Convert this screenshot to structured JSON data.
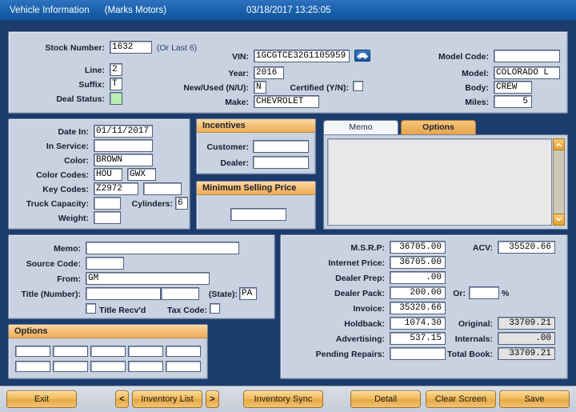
{
  "titlebar": {
    "title": "Vehicle Information",
    "dealer": "(Marks Motors)",
    "datetime": "03/18/2017 13:25:05"
  },
  "header_panel": {
    "stock_number_label": "Stock Number:",
    "stock_number_value": "1632",
    "stock_number_hint": "(Or Last 6)",
    "line_label": "Line:",
    "line_value": "2",
    "suffix_label": "Suffix:",
    "suffix_value": "T",
    "deal_status_label": "Deal Status:",
    "deal_status_value": "",
    "vin_label": "VIN:",
    "vin_value": "1GCGTCE32G1105959",
    "vin_icon": "car-icon",
    "year_label": "Year:",
    "year_value": "2016",
    "new_used_label": "New/Used (N/U):",
    "new_used_value": "N",
    "certified_label": "Certified (Y/N):",
    "certified_checked": false,
    "make_label": "Make:",
    "make_value": "CHEVROLET",
    "model_code_label": "Model Code:",
    "model_code_value": "",
    "model_label": "Model:",
    "model_value": "COLORADO L",
    "body_label": "Body:",
    "body_value": "CREW",
    "miles_label": "Miles:",
    "miles_value": "5"
  },
  "detail_panel": {
    "date_in_label": "Date In:",
    "date_in_value": "01/11/2017",
    "in_service_label": "In Service:",
    "in_service_value": "",
    "color_label": "Color:",
    "color_value": "BROWN",
    "color_codes_label": "Color Codes:",
    "color_code_1": "HOU",
    "color_code_2": "GWX",
    "key_codes_label": "Key Codes:",
    "key_code_1": "Z2972",
    "key_code_2": "",
    "truck_capacity_label": "Truck Capacity:",
    "truck_capacity_value": "",
    "cylinders_label": "Cylinders:",
    "cylinders_value": "6",
    "weight_label": "Weight:",
    "weight_value": ""
  },
  "incentives": {
    "header": "Incentives",
    "customer_label": "Customer:",
    "customer_value": "",
    "dealer_label": "Dealer:",
    "dealer_value": ""
  },
  "minimum_selling_price": {
    "header": "Minimum Selling Price",
    "value": ""
  },
  "tabs": {
    "memo_label": "Memo",
    "options_label": "Options",
    "active": "Options",
    "list_content": ""
  },
  "memo_panel": {
    "memo_label": "Memo:",
    "memo_value": "",
    "source_code_label": "Source Code:",
    "source_code_value": "",
    "from_label": "From:",
    "from_value": "GM",
    "title_number_label": "Title (Number):",
    "title_number_value": "",
    "title_number_value2": "",
    "state_label": "(State):",
    "state_value": "PA",
    "title_recvd_label": "Title Recv'd",
    "title_recvd_checked": false,
    "tax_code_label": "Tax Code:",
    "tax_code_value": ""
  },
  "options_panel": {
    "header": "Options",
    "cells": [
      "",
      "",
      "",
      "",
      "",
      "",
      "",
      "",
      "",
      ""
    ]
  },
  "pricing": {
    "msrp_label": "M.S.R.P:",
    "msrp_value": "36705.00",
    "internet_price_label": "Internet Price:",
    "internet_price_value": "36705.00",
    "dealer_prep_label": "Dealer Prep:",
    "dealer_prep_value": ".00",
    "dealer_pack_label": "Dealer Pack:",
    "dealer_pack_value": "200.00",
    "or_label": "Or:",
    "or_value": "",
    "percent_symbol": "%",
    "invoice_label": "Invoice:",
    "invoice_value": "35320.66",
    "holdback_label": "Holdback:",
    "holdback_value": "1074.30",
    "advertising_label": "Advertising:",
    "advertising_value": "537.15",
    "pending_repairs_label": "Pending Repairs:",
    "pending_repairs_value": "",
    "acv_label": "ACV:",
    "acv_value": "35520.66",
    "original_label": "Original:",
    "original_value": "33709.21",
    "internals_label": "Internals:",
    "internals_value": ".00",
    "total_book_label": "Total Book:",
    "total_book_value": "33709.21"
  },
  "buttons": {
    "exit": "Exit",
    "prev": "<",
    "inventory_list": "Inventory List",
    "next": ">",
    "inventory_sync": "Inventory Sync",
    "detail": "Detail",
    "clear_screen": "Clear Screen",
    "save": "Save"
  },
  "colors": {
    "title_bar_blue": "#1861ab",
    "window_navy": "#1d3c6e",
    "panel_gray": "#c9d2e0",
    "section_orange": "#f0bb6a",
    "button_gold": "#efbc60",
    "deal_status_green": "#b9eeb0"
  }
}
